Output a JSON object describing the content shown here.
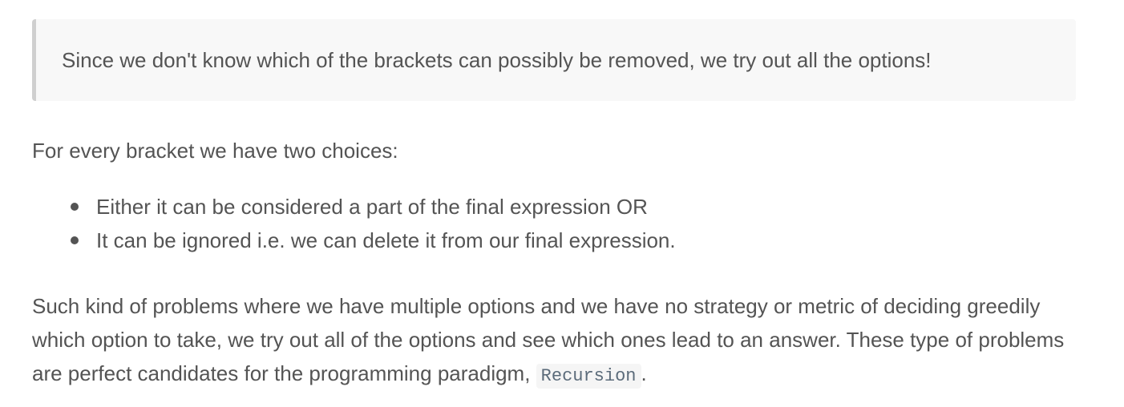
{
  "callout": {
    "text": "Since we don't know which of the brackets can possibly be removed, we try out all the options!"
  },
  "choices_intro": "For every bracket we have two choices:",
  "choices": [
    "Either it can be considered a part of the final expression OR",
    "It can be ignored i.e. we can delete it from our final expression."
  ],
  "paragraph": {
    "line1": "Such kind of problems where we have multiple options and we have no strategy or metric of deciding greedily which option to take, we try out all of the options and see which ones lead to an answer. These type of problems are perfect candidates for the programming paradigm,",
    "code": "Recursion",
    "trailing": "."
  }
}
